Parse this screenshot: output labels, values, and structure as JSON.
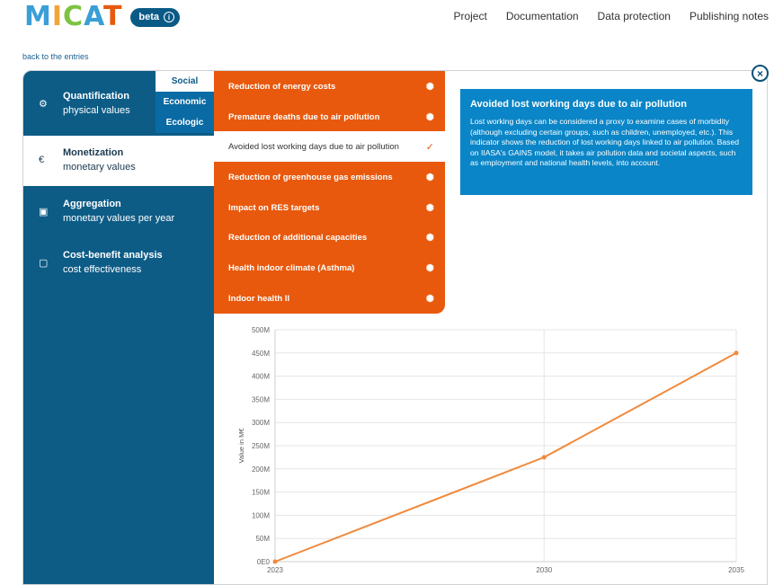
{
  "header": {
    "logo_letters": [
      {
        "ch": "M",
        "color": "#3a9fd6"
      },
      {
        "ch": "I",
        "color": "#f2a33a"
      },
      {
        "ch": "C",
        "color": "#7dc242"
      },
      {
        "ch": "A",
        "color": "#3a9fd6"
      },
      {
        "ch": "T",
        "color": "#e8590d"
      }
    ],
    "beta_label": "beta",
    "beta_icon": "i",
    "nav": [
      "Project",
      "Documentation",
      "Data protection",
      "Publishing notes"
    ]
  },
  "back_link": "back to the entries",
  "close_icon": "×",
  "sidebar": {
    "items": [
      {
        "icon": "⚙",
        "title": "Quantification",
        "subtitle": "physical values"
      },
      {
        "icon": "€",
        "title": "Monetization",
        "subtitle": "monetary values"
      },
      {
        "icon": "▣",
        "title": "Aggregation",
        "subtitle": "monetary values per year"
      },
      {
        "icon": "▢",
        "title": "Cost-benefit analysis",
        "subtitle": "cost effectiveness"
      }
    ],
    "active_index": 1,
    "subtabs": [
      "Social",
      "Economic",
      "Ecologic"
    ]
  },
  "indicators": {
    "items": [
      "Reduction of energy costs",
      "Premature deaths due to air pollution",
      "Avoided lost working days due to air pollution",
      "Reduction of greenhouse gas emissions",
      "Impact on RES targets",
      "Reduction of additional capacities",
      "Health indoor climate (Asthma)",
      "Indoor health II"
    ],
    "active_index": 2,
    "spark_icon": "✺",
    "check_icon": "✓"
  },
  "info": {
    "title": "Avoided lost working days due to air pollution",
    "text": "Lost working days can be considered a proxy to examine cases of morbidity (although excluding certain groups, such as children, unemployed, etc.). This indicator shows the reduction of lost working days linked to air pollution. Based on IIASA's GAINS model, it takes air pollution data and societal aspects, such as employment and national health levels, into account."
  },
  "chart_data": {
    "type": "line",
    "x": [
      "2023",
      "2030",
      "2035"
    ],
    "series": [
      {
        "values": [
          0,
          225000000,
          450000000
        ]
      }
    ],
    "ylabel": "Value in M€",
    "ylim": [
      0,
      500000000
    ],
    "yticks": [
      "0E0",
      "50M",
      "100M",
      "150M",
      "200M",
      "250M",
      "300M",
      "350M",
      "400M",
      "450M",
      "500M"
    ],
    "color": "#f08a3c",
    "grid": true
  },
  "colors": {
    "sidebar": "#0d5c86",
    "indicator_bg": "#e8590d",
    "info_bg": "#0a85c7"
  }
}
